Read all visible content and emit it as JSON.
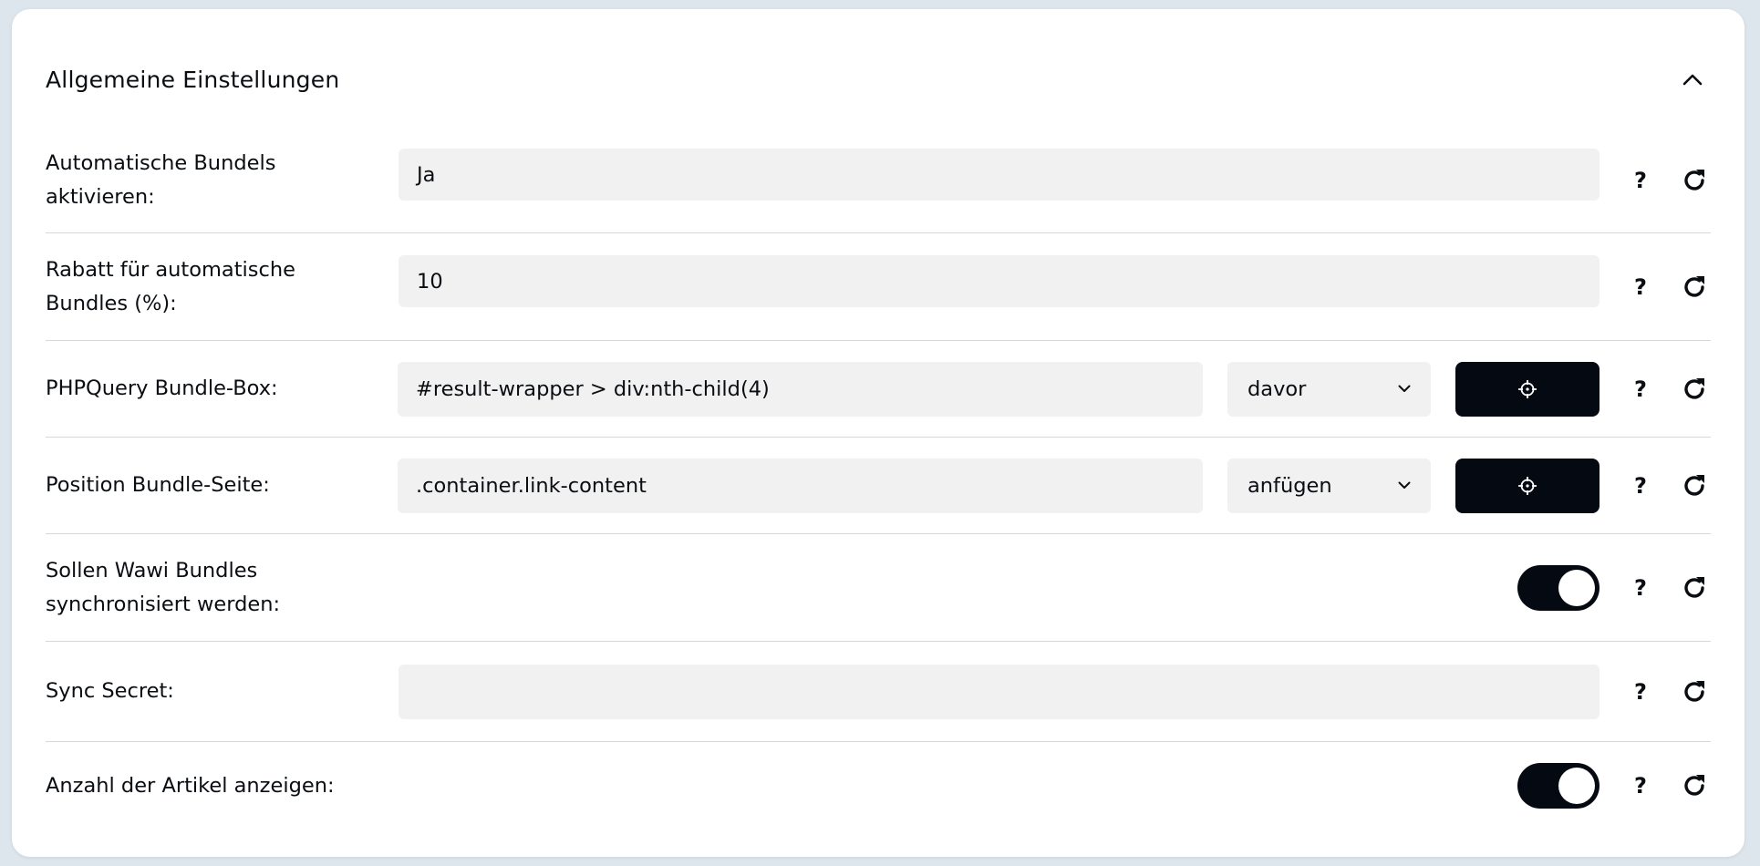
{
  "section": {
    "title": "Allgemeine Einstellungen"
  },
  "rows": [
    {
      "label": "Automatische Bundels aktivieren:",
      "value": "Ja"
    },
    {
      "label": "Rabatt für automatische Bundles (%):",
      "value": "10"
    },
    {
      "label": "PHPQuery Bundle-Box:",
      "value": "#result-wrapper > div:nth-child(4)",
      "select": "davor"
    },
    {
      "label": "Position Bundle-Seite:",
      "value": ".container.link-content",
      "select": "anfügen"
    },
    {
      "label": "Sollen Wawi Bundles synchronisiert werden:",
      "toggle": true
    },
    {
      "label": "Sync Secret:",
      "value": ""
    },
    {
      "label": "Anzahl der Artikel anzeigen:",
      "toggle": true
    }
  ],
  "help_label": "?",
  "icons": {
    "collapse": "chevron-up-icon",
    "help": "question-mark-icon",
    "reset": "refresh-icon",
    "picker": "crosshair-icon",
    "dropdown": "chevron-down-icon"
  },
  "colors": {
    "accent": "#050a12",
    "field_bg": "#f1f1f1",
    "page_bg": "#dde6ec"
  }
}
